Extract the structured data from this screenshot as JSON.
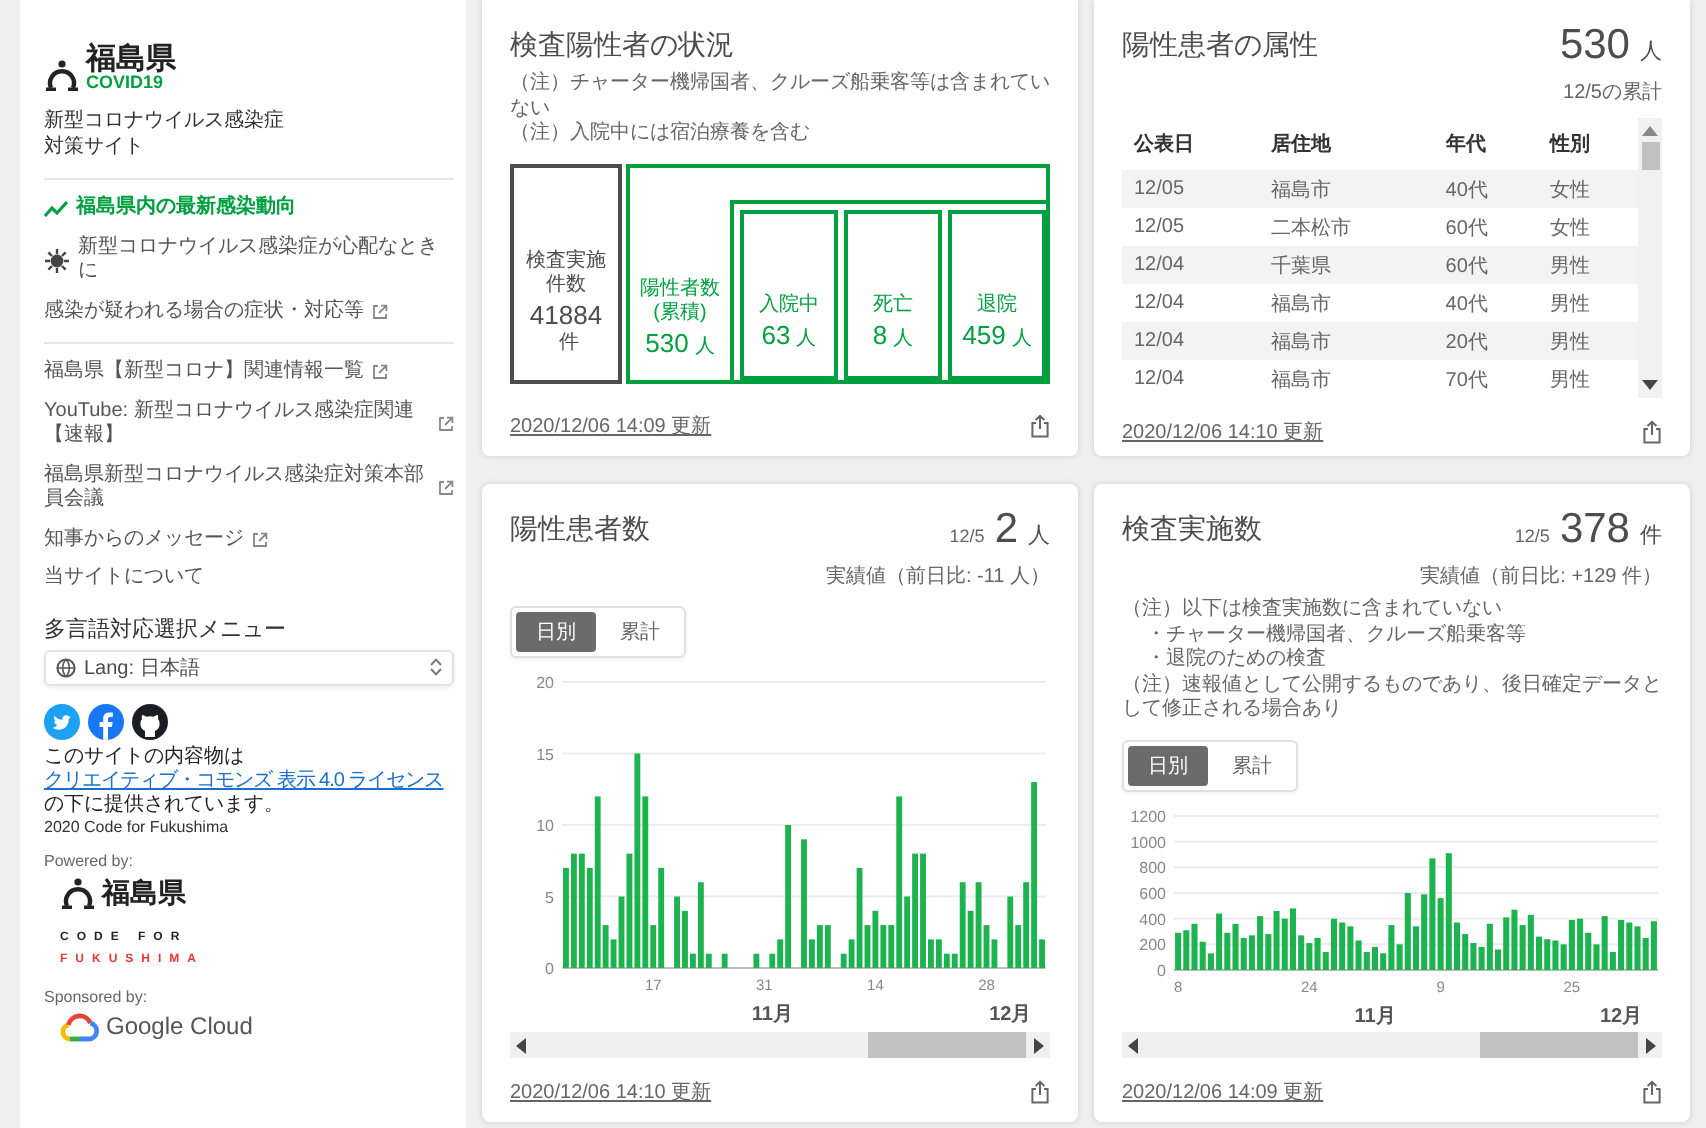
{
  "sidebar": {
    "logo": {
      "name": "福島県",
      "tag": "COVID19"
    },
    "subtitle": [
      "新型コロナウイルス感染症",
      "対策サイト"
    ],
    "nav_groups": [
      [
        {
          "label": "福島県内の最新感染動向",
          "external": false,
          "selected": true
        },
        {
          "label": "新型コロナウイルス感染症が心配なときに",
          "external": false,
          "selected": false
        },
        {
          "label": "感染が疑われる場合の症状・対応等",
          "external": true,
          "selected": false
        }
      ],
      [
        {
          "label": "福島県【新型コロナ】関連情報一覧",
          "external": true,
          "selected": false
        },
        {
          "label": "YouTube: 新型コロナウイルス感染症関連【速報】",
          "external": true,
          "selected": false
        },
        {
          "label": "福島県新型コロナウイルス感染症対策本部員会議",
          "external": true,
          "selected": false
        },
        {
          "label": "知事からのメッセージ",
          "external": true,
          "selected": false
        },
        {
          "label": "当サイトについて",
          "external": false,
          "selected": false
        }
      ]
    ],
    "language": {
      "heading": "多言語対応選択メニュー",
      "value": "Lang: 日本語"
    },
    "license": {
      "before": "このサイトの内容物は",
      "link": "クリエイティブ・コモンズ 表示 4.0 ライセンス",
      "after": "の下に提供されています。"
    },
    "copyright": "2020 Code for Fukushima",
    "powered_by": {
      "label": "Powered by:",
      "logo": "福島県"
    },
    "partner_logo": {
      "line_1": "CODE FOR",
      "line_2": "FUKUSHIMA"
    },
    "sponsored_by": {
      "label": "Sponsored by:",
      "logo": "Google Cloud"
    }
  },
  "cards": [
    {
      "kind": "status",
      "title": "検査陽性者の状況",
      "notes": [
        {
          "text": "（注）チャーター機帰国者、クルーズ船乗客等は含まれていない"
        },
        {
          "text": "（注）入院中には宿泊療養を含む"
        }
      ],
      "tests": {
        "label": "検査実施件数",
        "value": "41884",
        "unit": "件"
      },
      "positive": {
        "label": "陽性者数(累積)",
        "value": "530",
        "unit": "人"
      },
      "breakdown": [
        {
          "label": "入院中",
          "value": "63",
          "unit": "人"
        },
        {
          "label": "死亡",
          "value": "8",
          "unit": "人"
        },
        {
          "label": "退院",
          "value": "459",
          "unit": "人"
        }
      ],
      "updated": "2020/12/06 14:09 更新"
    },
    {
      "kind": "table",
      "title": "陽性患者の属性",
      "total": {
        "value": "530",
        "unit": "人"
      },
      "caption": "12/5の累計",
      "columns": [
        "公表日",
        "居住地",
        "年代",
        "性別"
      ],
      "rows": [
        [
          "12/05",
          "福島市",
          "40代",
          "女性"
        ],
        [
          "12/05",
          "二本松市",
          "60代",
          "女性"
        ],
        [
          "12/04",
          "千葉県",
          "60代",
          "男性"
        ],
        [
          "12/04",
          "福島市",
          "40代",
          "男性"
        ],
        [
          "12/04",
          "福島市",
          "20代",
          "男性"
        ],
        [
          "12/04",
          "福島市",
          "70代",
          "男性"
        ]
      ],
      "updated": "2020/12/06 14:10 更新"
    },
    {
      "kind": "chart",
      "title": "陽性患者数",
      "date": "12/5",
      "value": "2",
      "unit": "人",
      "caption": "実績値（前日比: -11 人）",
      "toggle": [
        {
          "label": "日別",
          "selected": true
        },
        {
          "label": "累計",
          "selected": false
        }
      ],
      "chart_data": {
        "type": "bar",
        "grid": true,
        "ylim": [
          0,
          20
        ],
        "yticks": [
          0,
          5,
          10,
          15,
          20
        ],
        "categories": [
          null,
          null,
          null,
          null,
          null,
          null,
          null,
          null,
          null,
          null,
          null,
          "17",
          null,
          null,
          null,
          null,
          null,
          null,
          null,
          null,
          null,
          null,
          null,
          null,
          null,
          "31",
          null,
          null,
          null,
          null,
          null,
          null,
          null,
          null,
          null,
          null,
          null,
          null,
          null,
          "14",
          null,
          null,
          null,
          null,
          null,
          null,
          null,
          null,
          null,
          null,
          null,
          null,
          null,
          "28",
          null,
          null,
          null,
          null,
          null,
          null,
          null
        ],
        "annotations": [
          "11月",
          "12月"
        ],
        "series": [
          {
            "color": "#1db450",
            "values": [
              7,
              8,
              8,
              7,
              12,
              3,
              2,
              5,
              8,
              15,
              12,
              3,
              7,
              0,
              5,
              4,
              1,
              6,
              1,
              0,
              1,
              0,
              0,
              0,
              1,
              0,
              1,
              2,
              10,
              0,
              9,
              2,
              3,
              3,
              0,
              1,
              2,
              7,
              3,
              4,
              3,
              3,
              12,
              5,
              8,
              8,
              2,
              2,
              1,
              1,
              6,
              4,
              6,
              3,
              2,
              0,
              5,
              3,
              6,
              13,
              2
            ]
          }
        ]
      },
      "updated": "2020/12/06 14:10 更新"
    },
    {
      "kind": "chart",
      "title": "検査実施数",
      "date": "12/5",
      "value": "378",
      "unit": "件",
      "caption": "実績値（前日比: +129 件）",
      "notes": [
        {
          "text": "（注）以下は検査実施数に含まれていない",
          "children": [
            {
              "text": "・チャーター機帰国者、クルーズ船乗客等"
            },
            {
              "text": "・退院のための検査"
            }
          ]
        },
        {
          "text": "（注）速報値として公開するものであり、後日確定データとして修正される場合あり"
        }
      ],
      "toggle": [
        {
          "label": "日別",
          "selected": true
        },
        {
          "label": "累計",
          "selected": false
        }
      ],
      "chart_data": {
        "type": "bar",
        "grid": true,
        "ylim": [
          0,
          1200
        ],
        "yticks": [
          0,
          200,
          400,
          600,
          800,
          1000,
          1200
        ],
        "categories": [
          "8",
          null,
          null,
          null,
          null,
          null,
          null,
          null,
          null,
          null,
          null,
          null,
          null,
          null,
          null,
          null,
          "24",
          null,
          null,
          null,
          null,
          null,
          null,
          null,
          null,
          null,
          null,
          null,
          null,
          null,
          null,
          null,
          "9",
          null,
          null,
          null,
          null,
          null,
          null,
          null,
          null,
          null,
          null,
          null,
          null,
          null,
          null,
          null,
          "25",
          null,
          null,
          null,
          null,
          null,
          null,
          null,
          null,
          null,
          null
        ],
        "annotations": [
          "11月",
          "12月"
        ],
        "series": [
          {
            "color": "#1db450",
            "values": [
              290,
              310,
              360,
              220,
              130,
              440,
              290,
              360,
              250,
              270,
              420,
              280,
              460,
              400,
              480,
              270,
              210,
              250,
              140,
              400,
              370,
              340,
              230,
              140,
              180,
              130,
              350,
              200,
              600,
              340,
              590,
              870,
              560,
              910,
              370,
              280,
              210,
              180,
              360,
              160,
              410,
              470,
              350,
              430,
              260,
              240,
              230,
              200,
              390,
              400,
              290,
              200,
              420,
              140,
              390,
              370,
              340,
              250,
              380
            ]
          }
        ]
      },
      "updated": "2020/12/06 14:09 更新"
    }
  ]
}
